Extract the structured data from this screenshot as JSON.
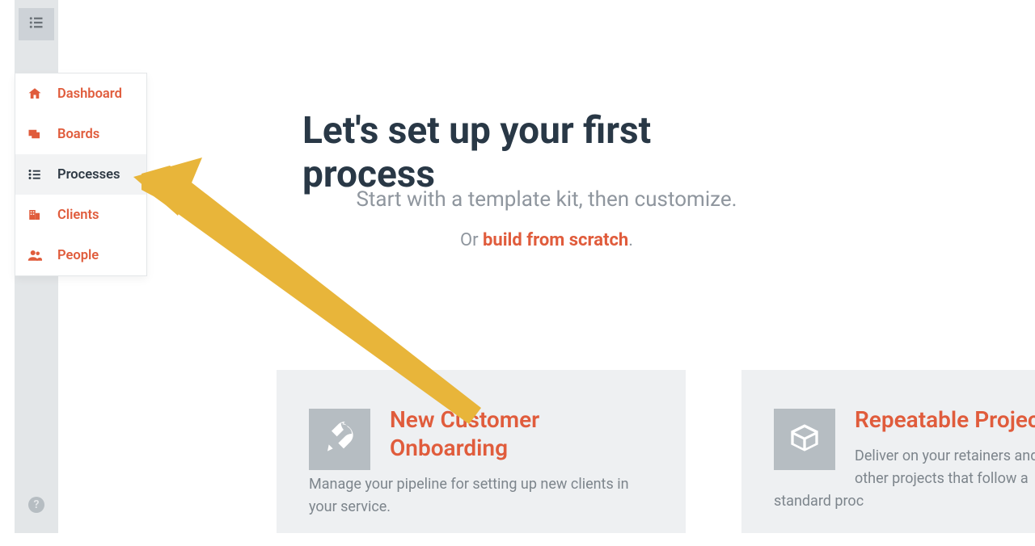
{
  "nav": {
    "items": [
      {
        "label": "Dashboard",
        "icon": "home-icon"
      },
      {
        "label": "Boards",
        "icon": "boards-icon"
      },
      {
        "label": "Processes",
        "icon": "process-list-icon",
        "selected": true
      },
      {
        "label": "Clients",
        "icon": "office-icon"
      },
      {
        "label": "People",
        "icon": "people-icon"
      }
    ]
  },
  "main": {
    "headline": "Let's set up your first process",
    "subline1": "Start with a template kit, then customize.",
    "subline2_prefix": "Or ",
    "subline2_link": "build from scratch",
    "subline2_suffix": "."
  },
  "cards": [
    {
      "title": "New Customer Onboarding",
      "description": "Manage your pipeline for setting up new clients in your service.",
      "icon": "rocket-icon"
    },
    {
      "title": "Repeatable Projects",
      "description": "Deliver on your retainers and other projects that follow a standard proc",
      "icon": "box-icon"
    }
  ],
  "colors": {
    "accent": "#e05c3c",
    "arrow": "#e8b53a",
    "rail": "#e3e6e8"
  }
}
